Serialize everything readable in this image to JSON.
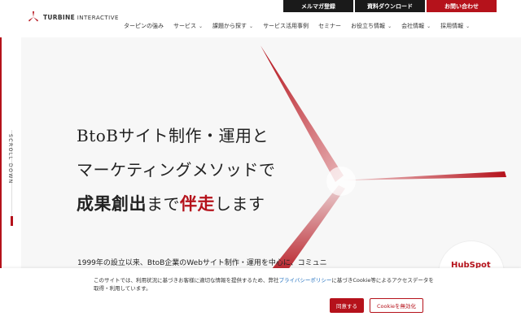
{
  "header": {
    "logo_brand": "TURBINE",
    "logo_sub": "INTERACTIVE",
    "top_buttons": [
      {
        "label": "メルマガ登録"
      },
      {
        "label": "資料ダウンロード"
      },
      {
        "label": "お問い合わせ"
      }
    ],
    "nav": [
      {
        "label": "ターピンの強み",
        "has_dropdown": false
      },
      {
        "label": "サービス",
        "has_dropdown": true
      },
      {
        "label": "課題から探す",
        "has_dropdown": true
      },
      {
        "label": "サービス活用事例",
        "has_dropdown": false
      },
      {
        "label": "セミナー",
        "has_dropdown": false
      },
      {
        "label": "お役立ち情報",
        "has_dropdown": true
      },
      {
        "label": "会社情報",
        "has_dropdown": true
      },
      {
        "label": "採用情報",
        "has_dropdown": true
      }
    ],
    "chevron": "⌄"
  },
  "hero": {
    "line1": "BtoBサイト制作・運用と",
    "line2": "マーケティングメソッドで",
    "line3_big": "成果創出",
    "line3_mid": "まで",
    "line3_red": "伴走",
    "line3_end": "します",
    "subtext": "1999年の設立以来、BtoB企業のWebサイト制作・運用を中心に、コミュニ",
    "scroll_label": "SCROLL DOWN",
    "hubspot_label": "HubSpot"
  },
  "cookie": {
    "text_before": "このサイトでは、利用状況に基づきお客様に適切な情報を提供するため、弊社",
    "link": "プライバシーポリシー",
    "text_after": "に基づきCookie等によるアクセスデータを取得・利用しています。",
    "accept": "同意する",
    "disable": "Cookieを無効化"
  },
  "colors": {
    "accent": "#b5121b",
    "dark": "#1a1a1a"
  }
}
